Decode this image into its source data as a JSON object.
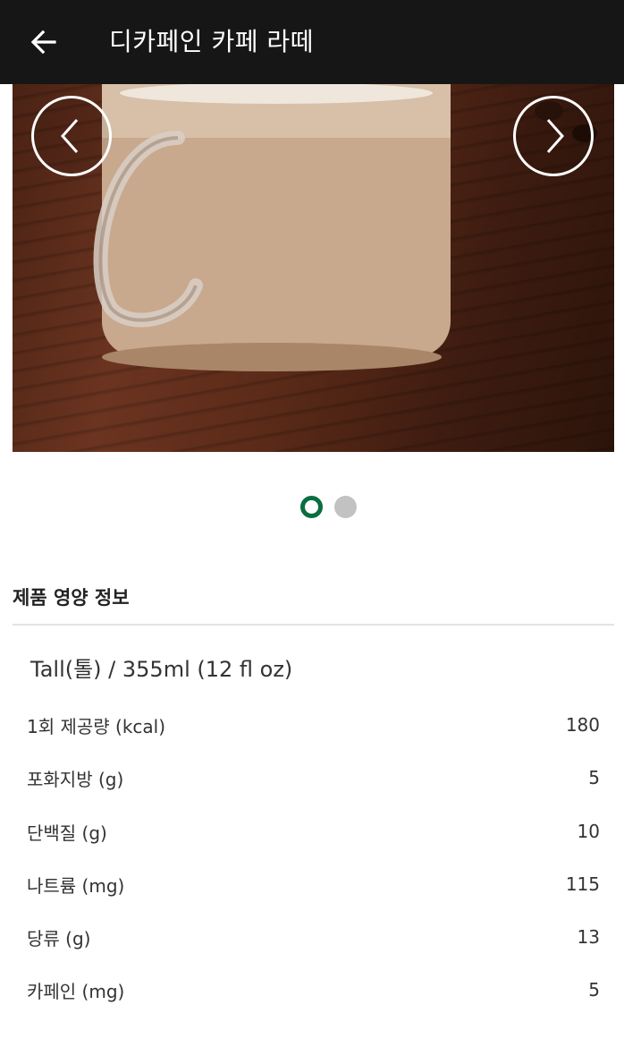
{
  "header": {
    "title": "디카페인 카페 라떼"
  },
  "nutrition": {
    "section_title": "제품 영양 정보",
    "size": "Tall(톨) / 355ml (12 fl oz)",
    "rows": [
      {
        "label": "1회 제공량 (kcal)",
        "value": "180"
      },
      {
        "label": "포화지방 (g)",
        "value": "5"
      },
      {
        "label": "단백질 (g)",
        "value": "10"
      },
      {
        "label": "나트륨 (mg)",
        "value": "115"
      },
      {
        "label": "당류 (g)",
        "value": "13"
      },
      {
        "label": "카페인 (mg)",
        "value": "5"
      }
    ]
  },
  "carousel": {
    "active_index": 0,
    "total": 2
  },
  "colors": {
    "appbar": "#161616",
    "accent": "#0b6e3f",
    "dot_inactive": "#c2c2c2"
  }
}
